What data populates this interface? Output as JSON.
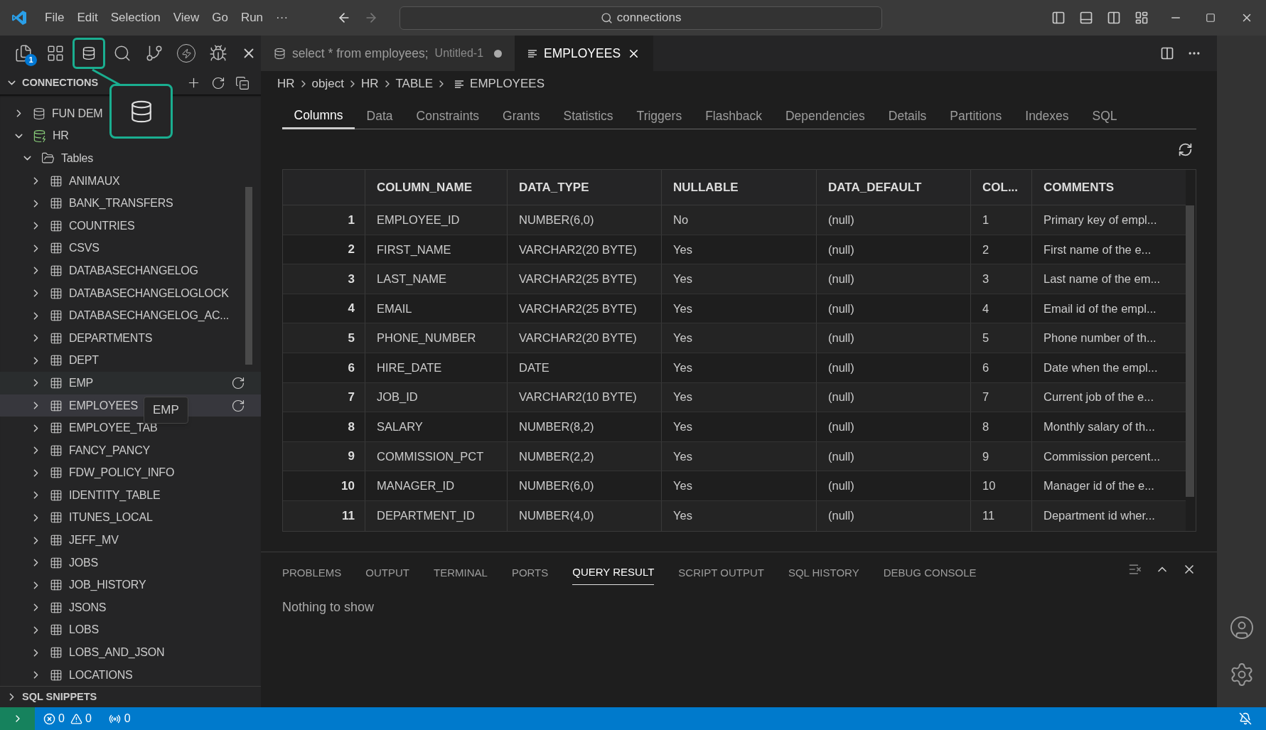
{
  "menu": [
    "File",
    "Edit",
    "Selection",
    "View",
    "Go",
    "Run",
    "···"
  ],
  "command_center": {
    "value": "connections"
  },
  "activity_badge": "1",
  "sidebar": {
    "title": "CONNECTIONS",
    "expanded": true,
    "tree": [
      {
        "label": "FUN DEM",
        "kind": "connection",
        "expanded": false,
        "selected": false,
        "hovered": false
      },
      {
        "label": "HR",
        "kind": "connection-live",
        "expanded": true,
        "selected": false,
        "hovered": false,
        "children": [
          {
            "label": "Tables",
            "kind": "folder",
            "expanded": true,
            "selected": false,
            "hovered": false,
            "children": [
              {
                "label": "ANIMAUX",
                "kind": "table",
                "expanded": false,
                "selected": false,
                "hovered": false
              },
              {
                "label": "BANK_TRANSFERS",
                "kind": "table",
                "expanded": false,
                "selected": false,
                "hovered": false
              },
              {
                "label": "COUNTRIES",
                "kind": "table",
                "expanded": false,
                "selected": false,
                "hovered": false
              },
              {
                "label": "CSVS",
                "kind": "table",
                "expanded": false,
                "selected": false,
                "hovered": false
              },
              {
                "label": "DATABASECHANGELOG",
                "kind": "table",
                "expanded": false,
                "selected": false,
                "hovered": false
              },
              {
                "label": "DATABASECHANGELOGLOCK",
                "kind": "table",
                "expanded": false,
                "selected": false,
                "hovered": false
              },
              {
                "label": "DATABASECHANGELOG_AC...",
                "kind": "table",
                "expanded": false,
                "selected": false,
                "hovered": false
              },
              {
                "label": "DEPARTMENTS",
                "kind": "table",
                "expanded": false,
                "selected": false,
                "hovered": false
              },
              {
                "label": "DEPT",
                "kind": "table",
                "expanded": false,
                "selected": false,
                "hovered": false
              },
              {
                "label": "EMP",
                "kind": "table",
                "expanded": false,
                "selected": false,
                "hovered": true
              },
              {
                "label": "EMPLOYEES",
                "kind": "table",
                "expanded": false,
                "selected": true,
                "hovered": false
              },
              {
                "label": "EMPLOYEE_TAB",
                "kind": "table",
                "expanded": false,
                "selected": false,
                "hovered": false
              },
              {
                "label": "FANCY_PANCY",
                "kind": "table",
                "expanded": false,
                "selected": false,
                "hovered": false
              },
              {
                "label": "FDW_POLICY_INFO",
                "kind": "table",
                "expanded": false,
                "selected": false,
                "hovered": false
              },
              {
                "label": "IDENTITY_TABLE",
                "kind": "table",
                "expanded": false,
                "selected": false,
                "hovered": false
              },
              {
                "label": "ITUNES_LOCAL",
                "kind": "table",
                "expanded": false,
                "selected": false,
                "hovered": false
              },
              {
                "label": "JEFF_MV",
                "kind": "table",
                "expanded": false,
                "selected": false,
                "hovered": false
              },
              {
                "label": "JOBS",
                "kind": "table",
                "expanded": false,
                "selected": false,
                "hovered": false
              },
              {
                "label": "JOB_HISTORY",
                "kind": "table",
                "expanded": false,
                "selected": false,
                "hovered": false
              },
              {
                "label": "JSONS",
                "kind": "table",
                "expanded": false,
                "selected": false,
                "hovered": false
              },
              {
                "label": "LOBS",
                "kind": "table",
                "expanded": false,
                "selected": false,
                "hovered": false
              },
              {
                "label": "LOBS_AND_JSON",
                "kind": "table",
                "expanded": false,
                "selected": false,
                "hovered": false
              },
              {
                "label": "LOCATIONS",
                "kind": "table",
                "expanded": false,
                "selected": false,
                "hovered": false
              }
            ]
          }
        ]
      }
    ],
    "footer": {
      "title": "SQL SNIPPETS",
      "expanded": false
    }
  },
  "tooltip": {
    "text": "EMP"
  },
  "editor_tabs": [
    {
      "kind": "sql",
      "title": "select * from employees;",
      "description": "Untitled-1",
      "dirty": true,
      "selected": false
    },
    {
      "kind": "table",
      "title": "EMPLOYEES",
      "dirty": false,
      "selected": true
    }
  ],
  "breadcrumbs": [
    "HR",
    "object",
    "HR",
    "TABLE",
    "EMPLOYEES"
  ],
  "detail_tabs": [
    {
      "label": "Columns",
      "selected": true
    },
    {
      "label": "Data",
      "selected": false
    },
    {
      "label": "Constraints",
      "selected": false
    },
    {
      "label": "Grants",
      "selected": false
    },
    {
      "label": "Statistics",
      "selected": false
    },
    {
      "label": "Triggers",
      "selected": false
    },
    {
      "label": "Flashback",
      "selected": false
    },
    {
      "label": "Dependencies",
      "selected": false
    },
    {
      "label": "Details",
      "selected": false
    },
    {
      "label": "Partitions",
      "selected": false
    },
    {
      "label": "Indexes",
      "selected": false
    },
    {
      "label": "SQL",
      "selected": false
    }
  ],
  "table": {
    "columns": [
      "COLUMN_NAME",
      "DATA_TYPE",
      "NULLABLE",
      "DATA_DEFAULT",
      "COL...",
      "COMMENTS"
    ],
    "rows": [
      {
        "n": "1",
        "cells": [
          "EMPLOYEE_ID",
          "NUMBER(6,0)",
          "No",
          "(null)",
          "1",
          "Primary key of empl..."
        ]
      },
      {
        "n": "2",
        "cells": [
          "FIRST_NAME",
          "VARCHAR2(20 BYTE)",
          "Yes",
          "(null)",
          "2",
          "First name of the e..."
        ]
      },
      {
        "n": "3",
        "cells": [
          "LAST_NAME",
          "VARCHAR2(25 BYTE)",
          "Yes",
          "(null)",
          "3",
          "Last name of the em..."
        ]
      },
      {
        "n": "4",
        "cells": [
          "EMAIL",
          "VARCHAR2(25 BYTE)",
          "Yes",
          "(null)",
          "4",
          "Email id of the empl..."
        ]
      },
      {
        "n": "5",
        "cells": [
          "PHONE_NUMBER",
          "VARCHAR2(20 BYTE)",
          "Yes",
          "(null)",
          "5",
          "Phone number of th..."
        ]
      },
      {
        "n": "6",
        "cells": [
          "HIRE_DATE",
          "DATE",
          "Yes",
          "(null)",
          "6",
          "Date when the empl..."
        ]
      },
      {
        "n": "7",
        "cells": [
          "JOB_ID",
          "VARCHAR2(10 BYTE)",
          "Yes",
          "(null)",
          "7",
          "Current job of the e..."
        ]
      },
      {
        "n": "8",
        "cells": [
          "SALARY",
          "NUMBER(8,2)",
          "Yes",
          "(null)",
          "8",
          "Monthly salary of th..."
        ]
      },
      {
        "n": "9",
        "cells": [
          "COMMISSION_PCT",
          "NUMBER(2,2)",
          "Yes",
          "(null)",
          "9",
          "Commission percent..."
        ]
      },
      {
        "n": "10",
        "cells": [
          "MANAGER_ID",
          "NUMBER(6,0)",
          "Yes",
          "(null)",
          "10",
          "Manager id of the e..."
        ]
      },
      {
        "n": "11",
        "cells": [
          "DEPARTMENT_ID",
          "NUMBER(4,0)",
          "Yes",
          "(null)",
          "11",
          "Department id wher..."
        ]
      }
    ]
  },
  "panel": {
    "tabs": [
      {
        "label": "PROBLEMS",
        "selected": false
      },
      {
        "label": "OUTPUT",
        "selected": false
      },
      {
        "label": "TERMINAL",
        "selected": false
      },
      {
        "label": "PORTS",
        "selected": false
      },
      {
        "label": "QUERY RESULT",
        "selected": true
      },
      {
        "label": "SCRIPT OUTPUT",
        "selected": false
      },
      {
        "label": "SQL HISTORY",
        "selected": false
      },
      {
        "label": "DEBUG CONSOLE",
        "selected": false
      }
    ],
    "message": "Nothing to show"
  },
  "status_bar": {
    "errors": "0",
    "warnings": "0",
    "ports": "0"
  }
}
